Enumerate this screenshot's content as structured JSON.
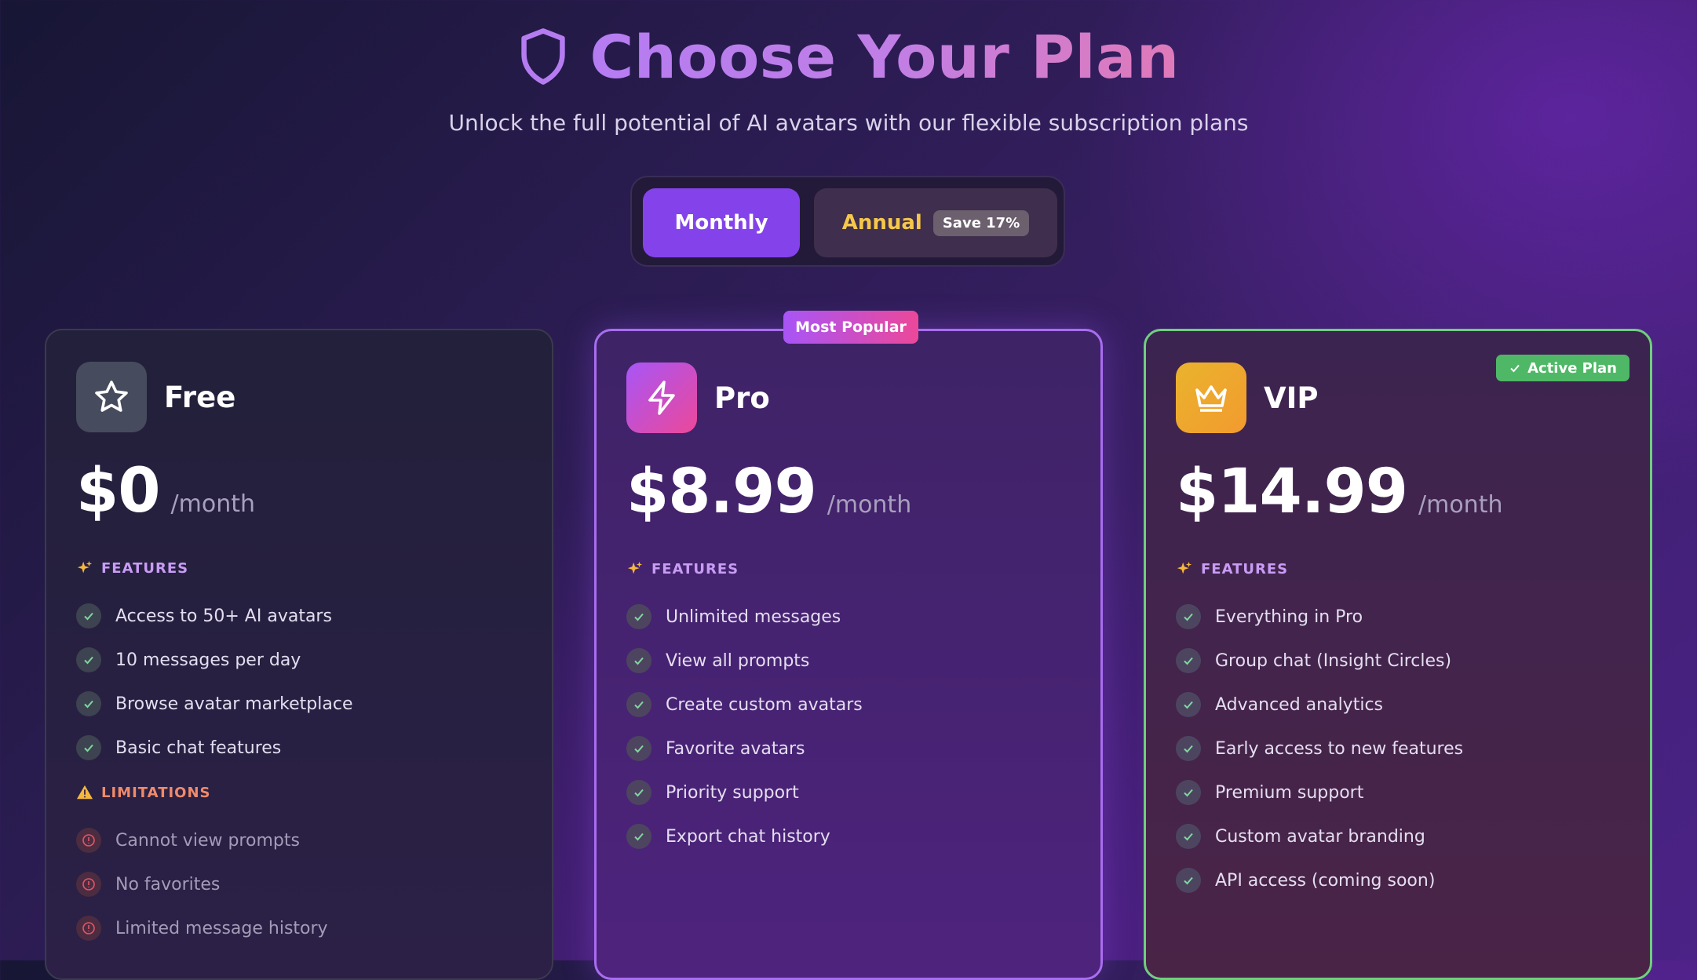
{
  "header": {
    "title": "Choose Your Plan",
    "subtitle": "Unlock the full potential of AI avatars with our flexible subscription plans",
    "icon": "shield-icon"
  },
  "billing_toggle": {
    "monthly_label": "Monthly",
    "annual_label": "Annual",
    "save_badge": "Save 17%",
    "selected": "Monthly"
  },
  "plans": [
    {
      "name": "Free",
      "icon": "star-icon",
      "price": "$0",
      "period": "/month",
      "features_title": "FEATURES",
      "features": [
        "Access to 50+ AI avatars",
        "10 messages per day",
        "Browse avatar marketplace",
        "Basic chat features"
      ],
      "limitations_title": "LIMITATIONS",
      "limitations": [
        "Cannot view prompts",
        "No favorites",
        "Limited message history"
      ]
    },
    {
      "name": "Pro",
      "icon": "lightning-icon",
      "badge": "Most Popular",
      "price": "$8.99",
      "period": "/month",
      "features_title": "FEATURES",
      "features": [
        "Unlimited messages",
        "View all prompts",
        "Create custom avatars",
        "Favorite avatars",
        "Priority support",
        "Export chat history"
      ]
    },
    {
      "name": "VIP",
      "icon": "crown-icon",
      "badge": "Active Plan",
      "price": "$14.99",
      "period": "/month",
      "features_title": "FEATURES",
      "features": [
        "Everything in Pro",
        "Group chat (Insight Circles)",
        "Advanced analytics",
        "Early access to new features",
        "Premium support",
        "Custom avatar branding",
        "API access (coming soon)"
      ]
    }
  ],
  "colors": {
    "accent_purple": "#8443ea",
    "annual_gold": "#f6c84a",
    "active_green": "#4fb866",
    "popular_gradient_start": "#a855f7",
    "popular_gradient_end": "#ec4899"
  }
}
